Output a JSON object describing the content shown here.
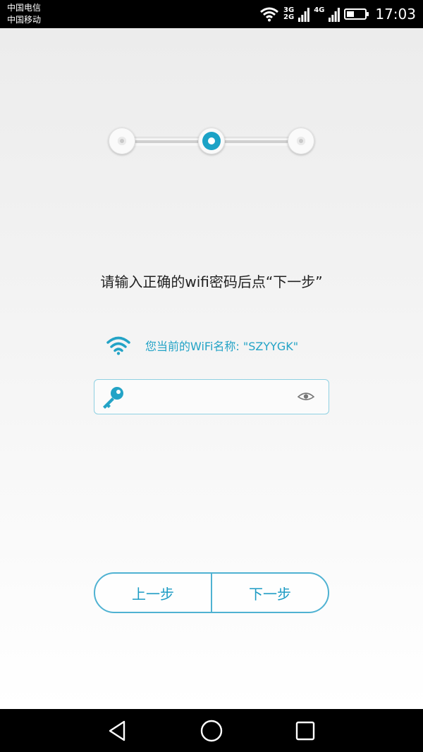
{
  "status_bar": {
    "carrier1": "中国电信",
    "carrier2": "中国移动",
    "net1_top": "3G",
    "net1_bottom": "2G",
    "net2": "4G",
    "time": "17:03",
    "battery_level": 0.4
  },
  "stepper": {
    "total_steps": 3,
    "current_step": 2
  },
  "instruction": "请输入正确的wifi密码后点“下一步”",
  "wifi": {
    "label": "您当前的WiFi名称:  \"SZYYGK\""
  },
  "password": {
    "value": "",
    "placeholder": ""
  },
  "buttons": {
    "prev": "上一步",
    "next": "下一步"
  },
  "colors": {
    "accent": "#1ba2c6",
    "border": "#4fb2d2"
  }
}
